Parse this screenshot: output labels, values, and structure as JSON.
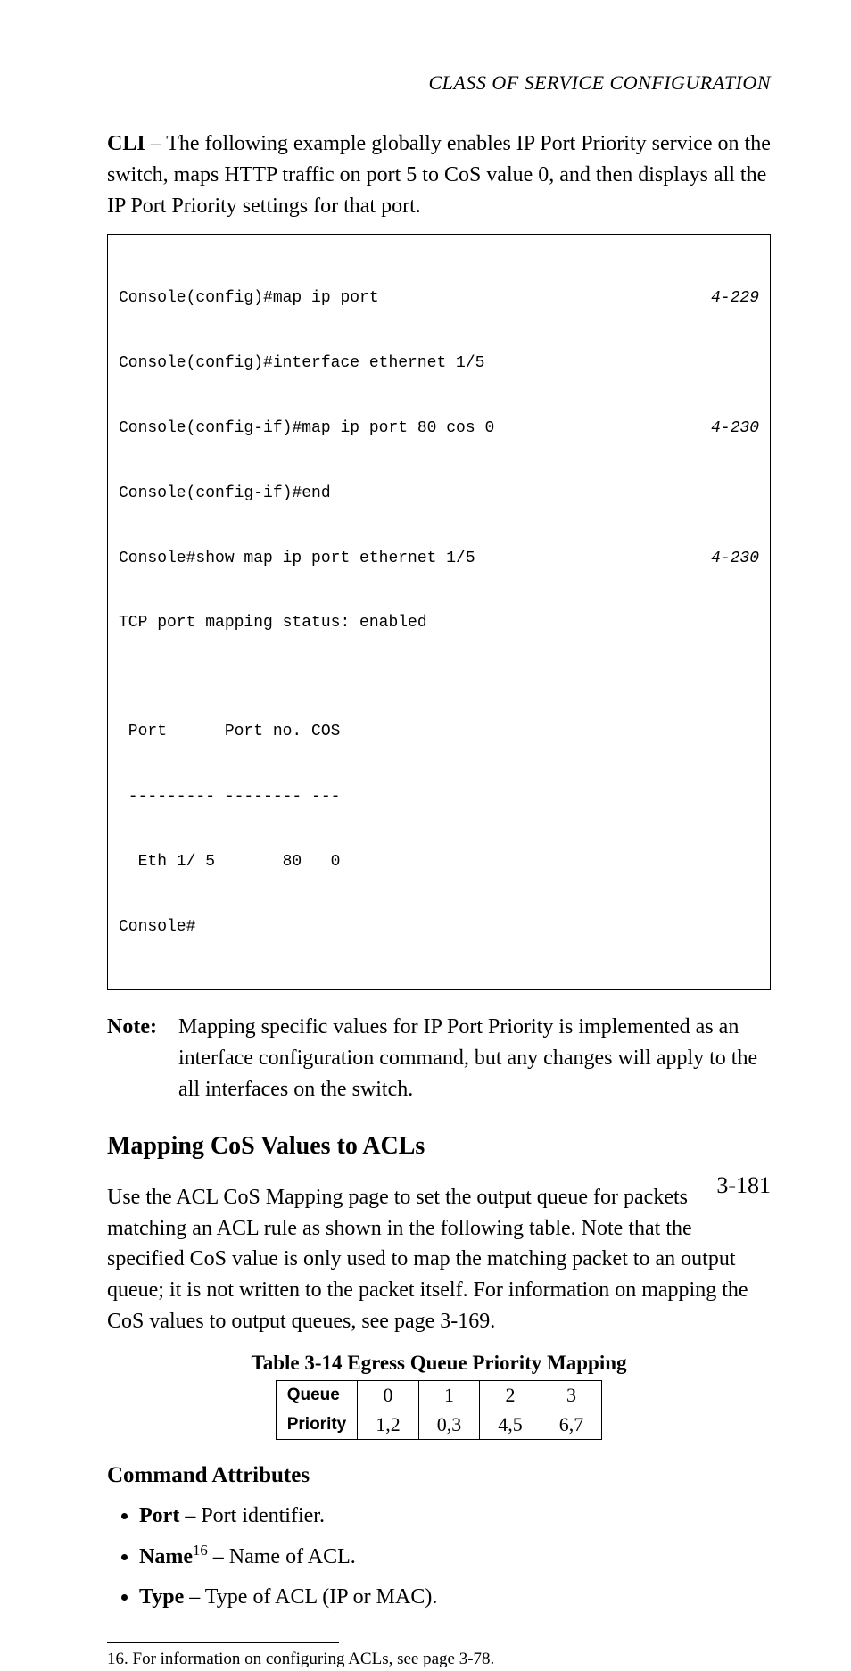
{
  "running_head": "CLASS OF SERVICE CONFIGURATION",
  "intro": {
    "lead_label": "CLI",
    "lead_text": " – The following example globally enables IP Port Priority service on the switch, maps HTTP traffic on port 5 to CoS value 0, and then displays all the IP Port Priority settings for that port."
  },
  "code": {
    "lines": [
      {
        "cmd": "Console(config)#map ip port",
        "ref": "4-229"
      },
      {
        "cmd": "Console(config)#interface ethernet 1/5",
        "ref": ""
      },
      {
        "cmd": "Console(config-if)#map ip port 80 cos 0",
        "ref": "4-230"
      },
      {
        "cmd": "Console(config-if)#end",
        "ref": ""
      },
      {
        "cmd": "Console#show map ip port ethernet 1/5",
        "ref": "4-230"
      },
      {
        "cmd": "TCP port mapping status: enabled",
        "ref": ""
      },
      {
        "cmd": "",
        "ref": ""
      },
      {
        "cmd": " Port      Port no. COS",
        "ref": ""
      },
      {
        "cmd": " --------- -------- ---",
        "ref": ""
      },
      {
        "cmd": "  Eth 1/ 5       80   0",
        "ref": ""
      },
      {
        "cmd": "Console#",
        "ref": ""
      }
    ]
  },
  "note": {
    "label": "Note:",
    "text": "Mapping specific values for IP Port Priority is implemented as an interface configuration command, but any changes will apply to the all interfaces on the switch."
  },
  "section": {
    "heading": "Mapping CoS Values to ACLs",
    "paragraph": "Use the ACL CoS Mapping page to set the output queue for packets matching an ACL rule as shown in the following table. Note that the specified CoS value is only used to map the matching packet to an output queue; it is not written to the packet itself. For information on mapping the CoS values to output queues, see page 3-169."
  },
  "table": {
    "caption": "Table 3-14  Egress Queue Priority Mapping",
    "rows": [
      {
        "header": "Queue",
        "cells": [
          "0",
          "1",
          "2",
          "3"
        ]
      },
      {
        "header": "Priority",
        "cells": [
          "1,2",
          "0,3",
          "4,5",
          "6,7"
        ]
      }
    ]
  },
  "chart_data": {
    "type": "table",
    "title": "Table 3-14  Egress Queue Priority Mapping",
    "columns": [
      "Queue",
      "0",
      "1",
      "2",
      "3"
    ],
    "rows": [
      [
        "Priority",
        "1,2",
        "0,3",
        "4,5",
        "6,7"
      ]
    ]
  },
  "attrs": {
    "heading": "Command Attributes",
    "items": [
      {
        "name": "Port",
        "sup": "",
        "desc": " – Port identifier."
      },
      {
        "name": "Name",
        "sup": "16",
        "desc": " – Name of ACL."
      },
      {
        "name": "Type",
        "sup": "",
        "desc": " – Type of ACL (IP or MAC)."
      }
    ]
  },
  "footnote": {
    "num": "16.",
    "text": " For information on configuring ACLs, see page 3-78."
  },
  "page_number": "3-181"
}
